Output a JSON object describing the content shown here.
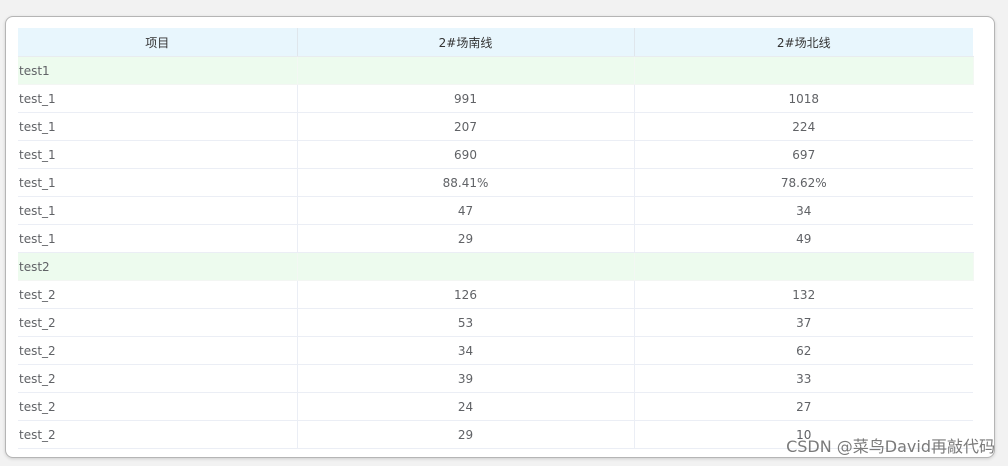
{
  "table": {
    "headers": [
      "项目",
      "2#场南线",
      "2#场北线"
    ],
    "rows": [
      {
        "type": "group",
        "cells": [
          "test1",
          "",
          ""
        ]
      },
      {
        "type": "data",
        "cells": [
          "test_1",
          "991",
          "1018"
        ]
      },
      {
        "type": "data",
        "cells": [
          "test_1",
          "207",
          "224"
        ]
      },
      {
        "type": "data",
        "cells": [
          "test_1",
          "690",
          "697"
        ]
      },
      {
        "type": "data",
        "cells": [
          "test_1",
          "88.41%",
          "78.62%"
        ]
      },
      {
        "type": "data",
        "cells": [
          "test_1",
          "47",
          "34"
        ]
      },
      {
        "type": "data",
        "cells": [
          "test_1",
          "29",
          "49"
        ]
      },
      {
        "type": "group",
        "cells": [
          "test2",
          "",
          ""
        ]
      },
      {
        "type": "data",
        "cells": [
          "test_2",
          "126",
          "132"
        ]
      },
      {
        "type": "data",
        "cells": [
          "test_2",
          "53",
          "37"
        ]
      },
      {
        "type": "data",
        "cells": [
          "test_2",
          "34",
          "62"
        ]
      },
      {
        "type": "data",
        "cells": [
          "test_2",
          "39",
          "33"
        ]
      },
      {
        "type": "data",
        "cells": [
          "test_2",
          "24",
          "27"
        ]
      },
      {
        "type": "data",
        "cells": [
          "test_2",
          "29",
          "10"
        ]
      }
    ]
  },
  "watermark": "CSDN @菜鸟David再敲代码",
  "colors": {
    "header_bg": "#e8f6fd",
    "group_row_bg": "#edfbee",
    "text": "#606266"
  }
}
